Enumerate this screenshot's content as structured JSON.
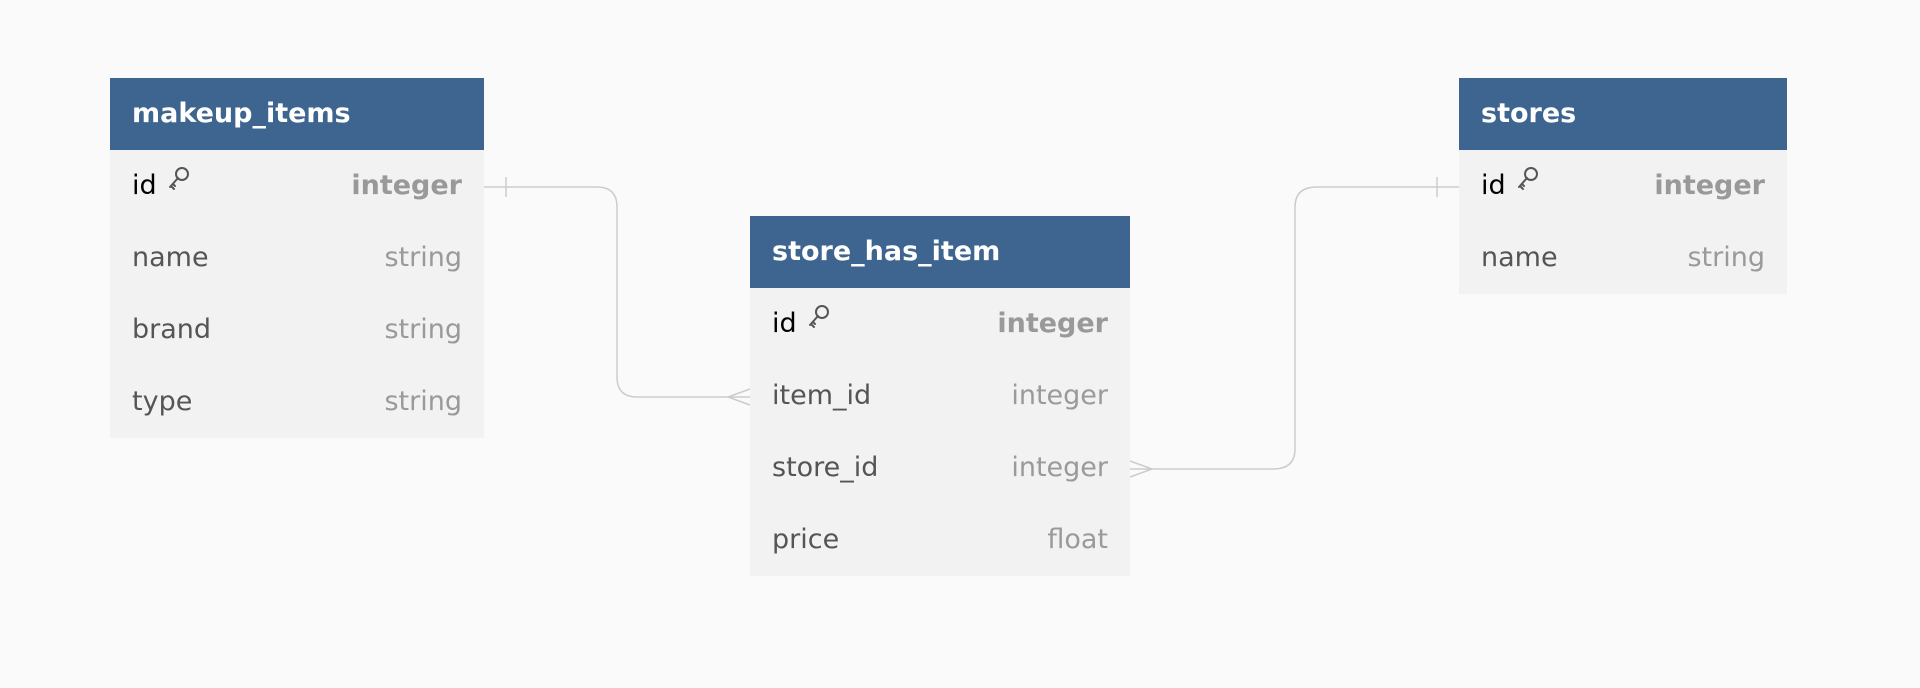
{
  "tables": [
    {
      "name": "makeup_items",
      "columns": [
        {
          "name": "id",
          "type": "integer",
          "primary_key": true
        },
        {
          "name": "name",
          "type": "string",
          "primary_key": false
        },
        {
          "name": "brand",
          "type": "string",
          "primary_key": false
        },
        {
          "name": "type",
          "type": "string",
          "primary_key": false
        }
      ]
    },
    {
      "name": "store_has_item",
      "columns": [
        {
          "name": "id",
          "type": "integer",
          "primary_key": true
        },
        {
          "name": "item_id",
          "type": "integer",
          "primary_key": false
        },
        {
          "name": "store_id",
          "type": "integer",
          "primary_key": false
        },
        {
          "name": "price",
          "type": "float",
          "primary_key": false
        }
      ]
    },
    {
      "name": "stores",
      "columns": [
        {
          "name": "id",
          "type": "integer",
          "primary_key": true
        },
        {
          "name": "name",
          "type": "string",
          "primary_key": false
        }
      ]
    }
  ],
  "relationships": [
    {
      "from": "makeup_items.id",
      "to": "store_has_item.item_id",
      "cardinality": "one-to-many"
    },
    {
      "from": "stores.id",
      "to": "store_has_item.store_id",
      "cardinality": "one-to-many"
    }
  ],
  "colors": {
    "background": "#fafafa",
    "header": "#3e6590",
    "header_text": "#ffffff",
    "body": "#f2f2f2",
    "column_name": "#555555",
    "column_type": "#9a9a9a",
    "connector": "#cccccc"
  },
  "icons": {
    "primary_key": "key-icon"
  }
}
